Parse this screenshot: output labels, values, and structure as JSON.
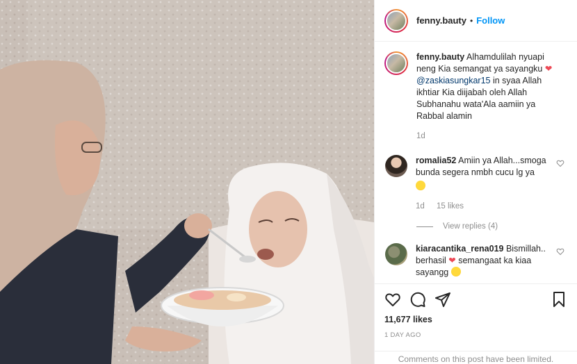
{
  "post": {
    "image_description_alt": "",
    "username": "fenny.bauty",
    "follow_label": "Follow",
    "dot": "•"
  },
  "caption": {
    "username": "fenny.bauty",
    "text_part1": "Alhamdulilah nyuapi neng Kia semangat ya sayangku",
    "heart": "❤",
    "mention": "@zaskiasungkar15",
    "text_part2": "in syaa Allah ikhtiar Kia diijabah oleh Allah Subhanahu wata'Ala aamiin ya Rabbal alamin",
    "time": "1d"
  },
  "comments": [
    {
      "username": "romalia52",
      "text": "Amiin ya Allah...smoga bunda segera nmbh cucu lg ya",
      "emoji": "smiling-face-with-heart-eyes",
      "time": "1d",
      "likes": "15 likes",
      "view_replies": "View replies (4)"
    },
    {
      "username": "kiaracantika_rena019",
      "text_part1": "Bismillah.. berhasil",
      "heart": "❤",
      "text_part2": "semangaat ka kiaa sayangg",
      "emoji": "hugging-face"
    }
  ],
  "actions": {
    "likes": "11,677 likes",
    "ago": "1 DAY AGO",
    "limited_notice": "Comments on this post have been limited."
  },
  "colors": {
    "link": "#0095f6",
    "mention": "#00376b",
    "heart": "#ed4956",
    "muted": "#8e8e8e"
  }
}
